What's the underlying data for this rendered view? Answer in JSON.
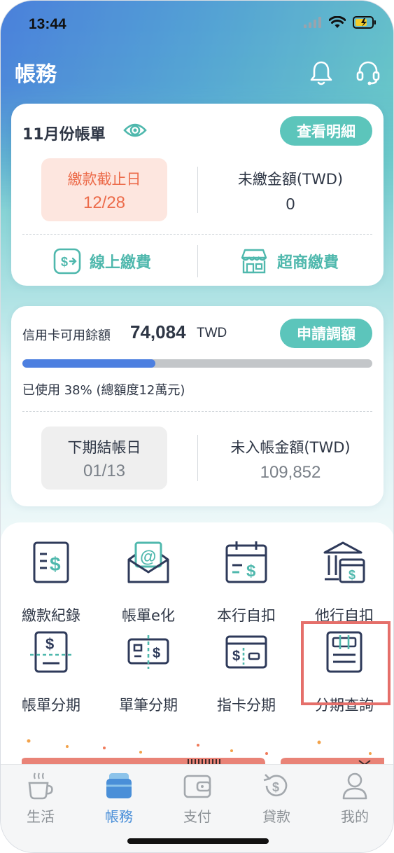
{
  "status": {
    "time": "13:44"
  },
  "header": {
    "title": "帳務"
  },
  "bill_card": {
    "title": "11月份帳單",
    "detail_button": "查看明細",
    "due_label": "繳款截止日",
    "due_date": "12/28",
    "unpaid_label": "未繳金額(TWD)",
    "unpaid_amount": "0",
    "online_pay": "線上繳費",
    "store_pay": "超商繳費"
  },
  "credit_card": {
    "available_label": "信用卡可用餘額",
    "available_amount": "74,084",
    "currency": "TWD",
    "adjust_button": "申請調額",
    "used_percent": 38,
    "used_text": "已使用 38% (總額度12萬元)",
    "next_close_label": "下期結帳日",
    "next_close_date": "01/13",
    "unbilled_label": "未入帳金額(TWD)",
    "unbilled_amount": "109,852"
  },
  "functions": [
    {
      "label": "繳款紀錄",
      "icon": "payment-record-icon"
    },
    {
      "label": "帳單e化",
      "icon": "ebill-envelope-icon"
    },
    {
      "label": "本行自扣",
      "icon": "calendar-dollar-icon"
    },
    {
      "label": "他行自扣",
      "icon": "bank-calendar-icon"
    },
    {
      "label": "帳單分期",
      "icon": "bill-installment-icon"
    },
    {
      "label": "單筆分期",
      "icon": "single-installment-icon"
    },
    {
      "label": "指卡分期",
      "icon": "card-installment-icon"
    },
    {
      "label": "分期查詢",
      "icon": "installment-query-icon"
    }
  ],
  "tabs": [
    {
      "label": "生活",
      "icon": "coffee-cup-icon",
      "active": false
    },
    {
      "label": "帳務",
      "icon": "card-stack-icon",
      "active": true
    },
    {
      "label": "支付",
      "icon": "wallet-icon",
      "active": false
    },
    {
      "label": "貸款",
      "icon": "loan-dollar-icon",
      "active": false
    },
    {
      "label": "我的",
      "icon": "person-icon",
      "active": false
    }
  ],
  "colors": {
    "accent_teal": "#5cc5bb",
    "due_orange": "#ec6b4a",
    "progress_blue": "#4c7fe0",
    "highlight_red": "#e56f6a",
    "tab_active": "#4a8fd8"
  }
}
